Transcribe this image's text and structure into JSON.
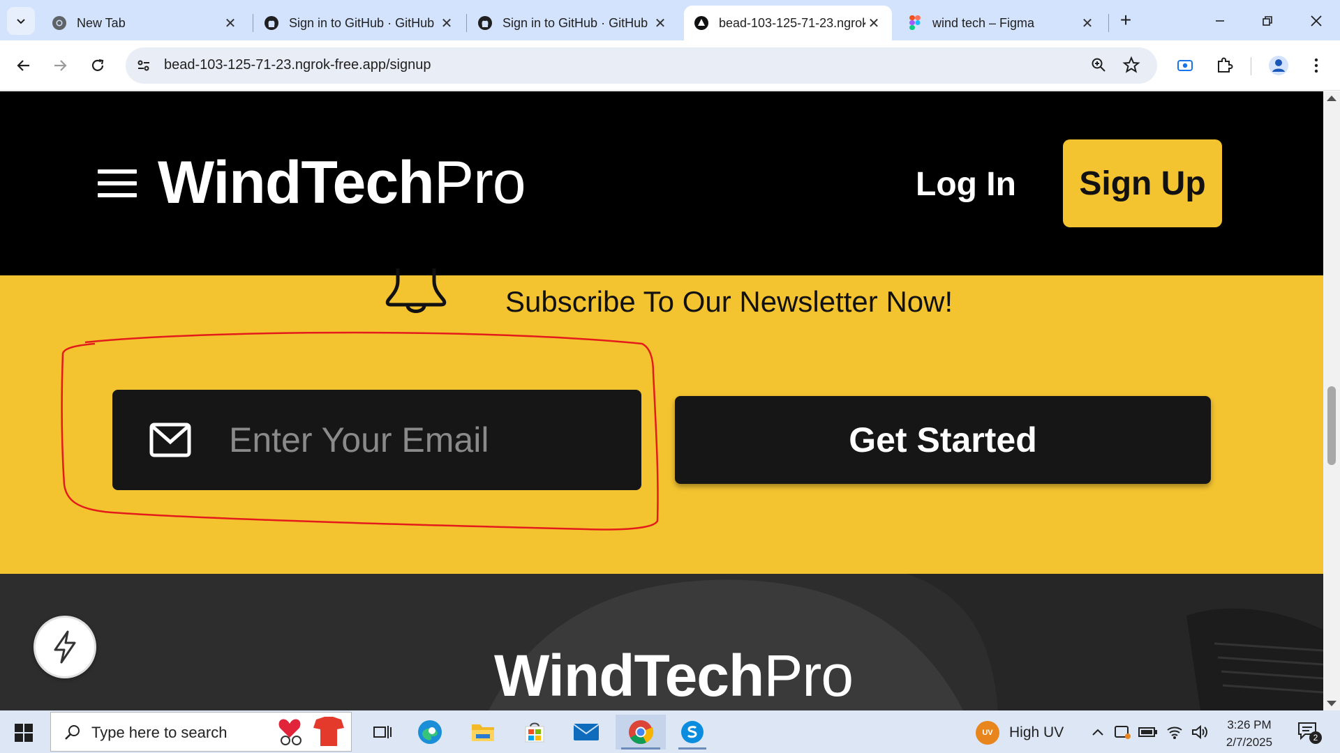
{
  "browser": {
    "tabs": [
      {
        "title": "New Tab",
        "icon": "chrome-icon",
        "active": false
      },
      {
        "title": "Sign in to GitHub · GitHub",
        "icon": "github-icon",
        "active": false
      },
      {
        "title": "Sign in to GitHub · GitHub",
        "icon": "github-icon",
        "active": false
      },
      {
        "title": "bead-103-125-71-23.ngrok-free.app",
        "icon": "nextjs-icon",
        "active": true
      },
      {
        "title": "wind tech – Figma",
        "icon": "figma-icon",
        "active": false
      }
    ],
    "url": "bead-103-125-71-23.ngrok-free.app/signup",
    "new_tab_label": "+"
  },
  "site": {
    "logo_bold": "WindTech",
    "logo_light": "Pro",
    "login_label": "Log In",
    "signup_label": "Sign Up",
    "newsletter_title": "Subscribe To Our Newsletter Now!",
    "email_placeholder": "Enter Your Email",
    "cta_label": "Get Started",
    "footer_logo_bold": "WindTech",
    "footer_logo_light": "Pro",
    "accent_color": "#f4c430"
  },
  "taskbar": {
    "search_placeholder": "Type here to search",
    "weather_badge": "UV",
    "weather_text": "High UV",
    "time": "3:26 PM",
    "date": "2/7/2025",
    "notification_count": "2"
  }
}
